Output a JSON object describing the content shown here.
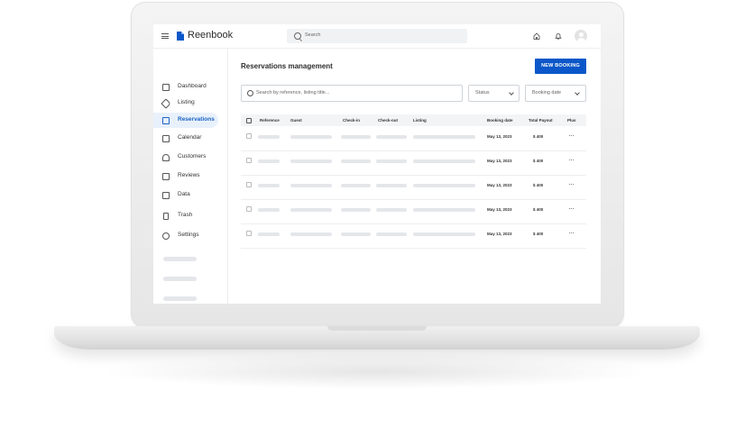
{
  "app": {
    "brand": "Reenbook",
    "accent": "#0b57c9",
    "search_placeholder": "Search"
  },
  "sidebar": {
    "items": [
      {
        "label": "Dashboard",
        "icon": "dashboard-icon",
        "active": false
      },
      {
        "label": "Listing",
        "icon": "tag-icon",
        "active": false
      },
      {
        "label": "Reservations",
        "icon": "reservations-icon",
        "active": true
      },
      {
        "label": "Calendar",
        "icon": "calendar-icon",
        "active": false
      },
      {
        "label": "Customers",
        "icon": "customers-icon",
        "active": false
      },
      {
        "label": "Reviews",
        "icon": "reviews-icon",
        "active": false
      },
      {
        "label": "Data",
        "icon": "data-icon",
        "active": false
      },
      {
        "label": "Trash",
        "icon": "trash-icon",
        "active": false
      },
      {
        "label": "Settings",
        "icon": "settings-icon",
        "active": false
      }
    ]
  },
  "main": {
    "title": "Reservations management",
    "new_button": "NEW BOOKING",
    "filter_search_placeholder": "Search by reference, listing title...",
    "status_label": "Status",
    "booking_date_label": "Booking date",
    "columns": [
      "Reference",
      "Guest",
      "Check-in",
      "Check-out",
      "Listing",
      "Booking date",
      "Total Payout",
      "Plus"
    ],
    "rows": [
      {
        "booking_date": "May 13, 2023",
        "payout": "$ 400",
        "more": "···"
      },
      {
        "booking_date": "May 13, 2023",
        "payout": "$ 400",
        "more": "···"
      },
      {
        "booking_date": "May 13, 2023",
        "payout": "$ 400",
        "more": "···"
      },
      {
        "booking_date": "May 13, 2023",
        "payout": "$ 400",
        "more": "···"
      },
      {
        "booking_date": "May 13, 2023",
        "payout": "$ 400",
        "more": "···"
      }
    ]
  }
}
